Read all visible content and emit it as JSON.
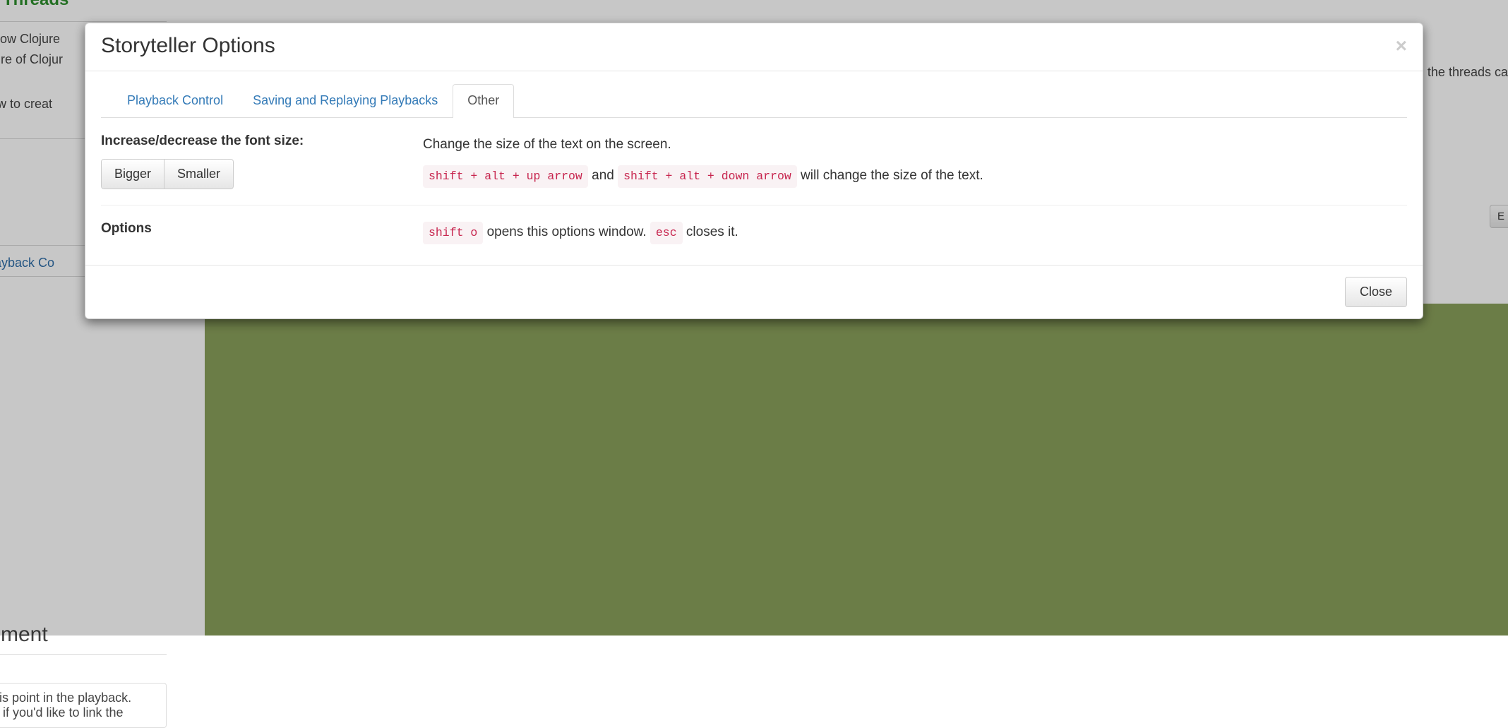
{
  "background": {
    "title": "Threads",
    "para1a": "s how Clojure",
    "para1b": "ature of Clojur",
    "para2": " how to creat",
    "right_hint": "the threads ca",
    "right_button": "E",
    "link_text": " Playback Co",
    "mm_heading": "mment",
    "card_line1": "his point in the playback.",
    "card_line2": "e if you'd like to link the"
  },
  "modal": {
    "title": "Storyteller Options",
    "close_x": "×",
    "tabs": [
      {
        "label": "Playback Control",
        "active": false
      },
      {
        "label": "Saving and Replaying Playbacks",
        "active": false
      },
      {
        "label": "Other",
        "active": true
      }
    ],
    "rows": [
      {
        "label": "Increase/decrease the font size:",
        "buttons": [
          "Bigger",
          "Smaller"
        ],
        "desc_plain1": "Change the size of the text on the screen.",
        "kbd1": "shift + alt + up arrow",
        "mid1": " and ",
        "kbd2": "shift + alt + down arrow",
        "trail1": " will change the size of the text."
      },
      {
        "label": "Options",
        "kbd1": "shift o",
        "mid1": " opens this options window. ",
        "kbd2": "esc",
        "trail1": " closes it."
      }
    ],
    "footer": {
      "close_label": "Close"
    }
  }
}
